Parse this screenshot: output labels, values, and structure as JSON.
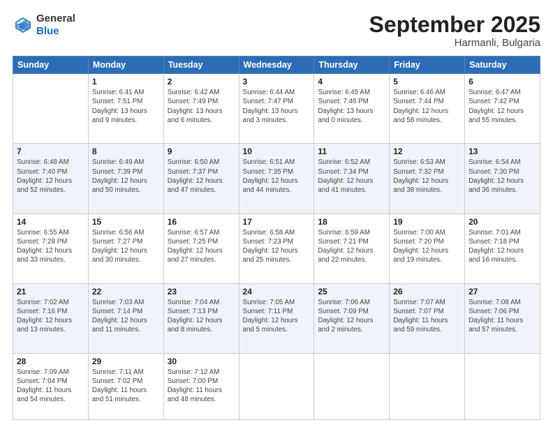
{
  "header": {
    "logo_general": "General",
    "logo_blue": "Blue",
    "month_title": "September 2025",
    "location": "Harmanli, Bulgaria"
  },
  "days_of_week": [
    "Sunday",
    "Monday",
    "Tuesday",
    "Wednesday",
    "Thursday",
    "Friday",
    "Saturday"
  ],
  "weeks": [
    [
      {
        "day": "",
        "sunrise": "",
        "sunset": "",
        "daylight": ""
      },
      {
        "day": "1",
        "sunrise": "Sunrise: 6:41 AM",
        "sunset": "Sunset: 7:51 PM",
        "daylight": "Daylight: 13 hours",
        "daylight2": "and 9 minutes."
      },
      {
        "day": "2",
        "sunrise": "Sunrise: 6:42 AM",
        "sunset": "Sunset: 7:49 PM",
        "daylight": "Daylight: 13 hours",
        "daylight2": "and 6 minutes."
      },
      {
        "day": "3",
        "sunrise": "Sunrise: 6:44 AM",
        "sunset": "Sunset: 7:47 PM",
        "daylight": "Daylight: 13 hours",
        "daylight2": "and 3 minutes."
      },
      {
        "day": "4",
        "sunrise": "Sunrise: 6:45 AM",
        "sunset": "Sunset: 7:46 PM",
        "daylight": "Daylight: 13 hours",
        "daylight2": "and 0 minutes."
      },
      {
        "day": "5",
        "sunrise": "Sunrise: 6:46 AM",
        "sunset": "Sunset: 7:44 PM",
        "daylight": "Daylight: 12 hours",
        "daylight2": "and 58 minutes."
      },
      {
        "day": "6",
        "sunrise": "Sunrise: 6:47 AM",
        "sunset": "Sunset: 7:42 PM",
        "daylight": "Daylight: 12 hours",
        "daylight2": "and 55 minutes."
      }
    ],
    [
      {
        "day": "7",
        "sunrise": "Sunrise: 6:48 AM",
        "sunset": "Sunset: 7:40 PM",
        "daylight": "Daylight: 12 hours",
        "daylight2": "and 52 minutes."
      },
      {
        "day": "8",
        "sunrise": "Sunrise: 6:49 AM",
        "sunset": "Sunset: 7:39 PM",
        "daylight": "Daylight: 12 hours",
        "daylight2": "and 50 minutes."
      },
      {
        "day": "9",
        "sunrise": "Sunrise: 6:50 AM",
        "sunset": "Sunset: 7:37 PM",
        "daylight": "Daylight: 12 hours",
        "daylight2": "and 47 minutes."
      },
      {
        "day": "10",
        "sunrise": "Sunrise: 6:51 AM",
        "sunset": "Sunset: 7:35 PM",
        "daylight": "Daylight: 12 hours",
        "daylight2": "and 44 minutes."
      },
      {
        "day": "11",
        "sunrise": "Sunrise: 6:52 AM",
        "sunset": "Sunset: 7:34 PM",
        "daylight": "Daylight: 12 hours",
        "daylight2": "and 41 minutes."
      },
      {
        "day": "12",
        "sunrise": "Sunrise: 6:53 AM",
        "sunset": "Sunset: 7:32 PM",
        "daylight": "Daylight: 12 hours",
        "daylight2": "and 38 minutes."
      },
      {
        "day": "13",
        "sunrise": "Sunrise: 6:54 AM",
        "sunset": "Sunset: 7:30 PM",
        "daylight": "Daylight: 12 hours",
        "daylight2": "and 36 minutes."
      }
    ],
    [
      {
        "day": "14",
        "sunrise": "Sunrise: 6:55 AM",
        "sunset": "Sunset: 7:28 PM",
        "daylight": "Daylight: 12 hours",
        "daylight2": "and 33 minutes."
      },
      {
        "day": "15",
        "sunrise": "Sunrise: 6:56 AM",
        "sunset": "Sunset: 7:27 PM",
        "daylight": "Daylight: 12 hours",
        "daylight2": "and 30 minutes."
      },
      {
        "day": "16",
        "sunrise": "Sunrise: 6:57 AM",
        "sunset": "Sunset: 7:25 PM",
        "daylight": "Daylight: 12 hours",
        "daylight2": "and 27 minutes."
      },
      {
        "day": "17",
        "sunrise": "Sunrise: 6:58 AM",
        "sunset": "Sunset: 7:23 PM",
        "daylight": "Daylight: 12 hours",
        "daylight2": "and 25 minutes."
      },
      {
        "day": "18",
        "sunrise": "Sunrise: 6:59 AM",
        "sunset": "Sunset: 7:21 PM",
        "daylight": "Daylight: 12 hours",
        "daylight2": "and 22 minutes."
      },
      {
        "day": "19",
        "sunrise": "Sunrise: 7:00 AM",
        "sunset": "Sunset: 7:20 PM",
        "daylight": "Daylight: 12 hours",
        "daylight2": "and 19 minutes."
      },
      {
        "day": "20",
        "sunrise": "Sunrise: 7:01 AM",
        "sunset": "Sunset: 7:18 PM",
        "daylight": "Daylight: 12 hours",
        "daylight2": "and 16 minutes."
      }
    ],
    [
      {
        "day": "21",
        "sunrise": "Sunrise: 7:02 AM",
        "sunset": "Sunset: 7:16 PM",
        "daylight": "Daylight: 12 hours",
        "daylight2": "and 13 minutes."
      },
      {
        "day": "22",
        "sunrise": "Sunrise: 7:03 AM",
        "sunset": "Sunset: 7:14 PM",
        "daylight": "Daylight: 12 hours",
        "daylight2": "and 11 minutes."
      },
      {
        "day": "23",
        "sunrise": "Sunrise: 7:04 AM",
        "sunset": "Sunset: 7:13 PM",
        "daylight": "Daylight: 12 hours",
        "daylight2": "and 8 minutes."
      },
      {
        "day": "24",
        "sunrise": "Sunrise: 7:05 AM",
        "sunset": "Sunset: 7:11 PM",
        "daylight": "Daylight: 12 hours",
        "daylight2": "and 5 minutes."
      },
      {
        "day": "25",
        "sunrise": "Sunrise: 7:06 AM",
        "sunset": "Sunset: 7:09 PM",
        "daylight": "Daylight: 12 hours",
        "daylight2": "and 2 minutes."
      },
      {
        "day": "26",
        "sunrise": "Sunrise: 7:07 AM",
        "sunset": "Sunset: 7:07 PM",
        "daylight": "Daylight: 11 hours",
        "daylight2": "and 59 minutes."
      },
      {
        "day": "27",
        "sunrise": "Sunrise: 7:08 AM",
        "sunset": "Sunset: 7:06 PM",
        "daylight": "Daylight: 11 hours",
        "daylight2": "and 57 minutes."
      }
    ],
    [
      {
        "day": "28",
        "sunrise": "Sunrise: 7:09 AM",
        "sunset": "Sunset: 7:04 PM",
        "daylight": "Daylight: 11 hours",
        "daylight2": "and 54 minutes."
      },
      {
        "day": "29",
        "sunrise": "Sunrise: 7:11 AM",
        "sunset": "Sunset: 7:02 PM",
        "daylight": "Daylight: 11 hours",
        "daylight2": "and 51 minutes."
      },
      {
        "day": "30",
        "sunrise": "Sunrise: 7:12 AM",
        "sunset": "Sunset: 7:00 PM",
        "daylight": "Daylight: 11 hours",
        "daylight2": "and 48 minutes."
      },
      {
        "day": "",
        "sunrise": "",
        "sunset": "",
        "daylight": ""
      },
      {
        "day": "",
        "sunrise": "",
        "sunset": "",
        "daylight": ""
      },
      {
        "day": "",
        "sunrise": "",
        "sunset": "",
        "daylight": ""
      },
      {
        "day": "",
        "sunrise": "",
        "sunset": "",
        "daylight": ""
      }
    ]
  ]
}
